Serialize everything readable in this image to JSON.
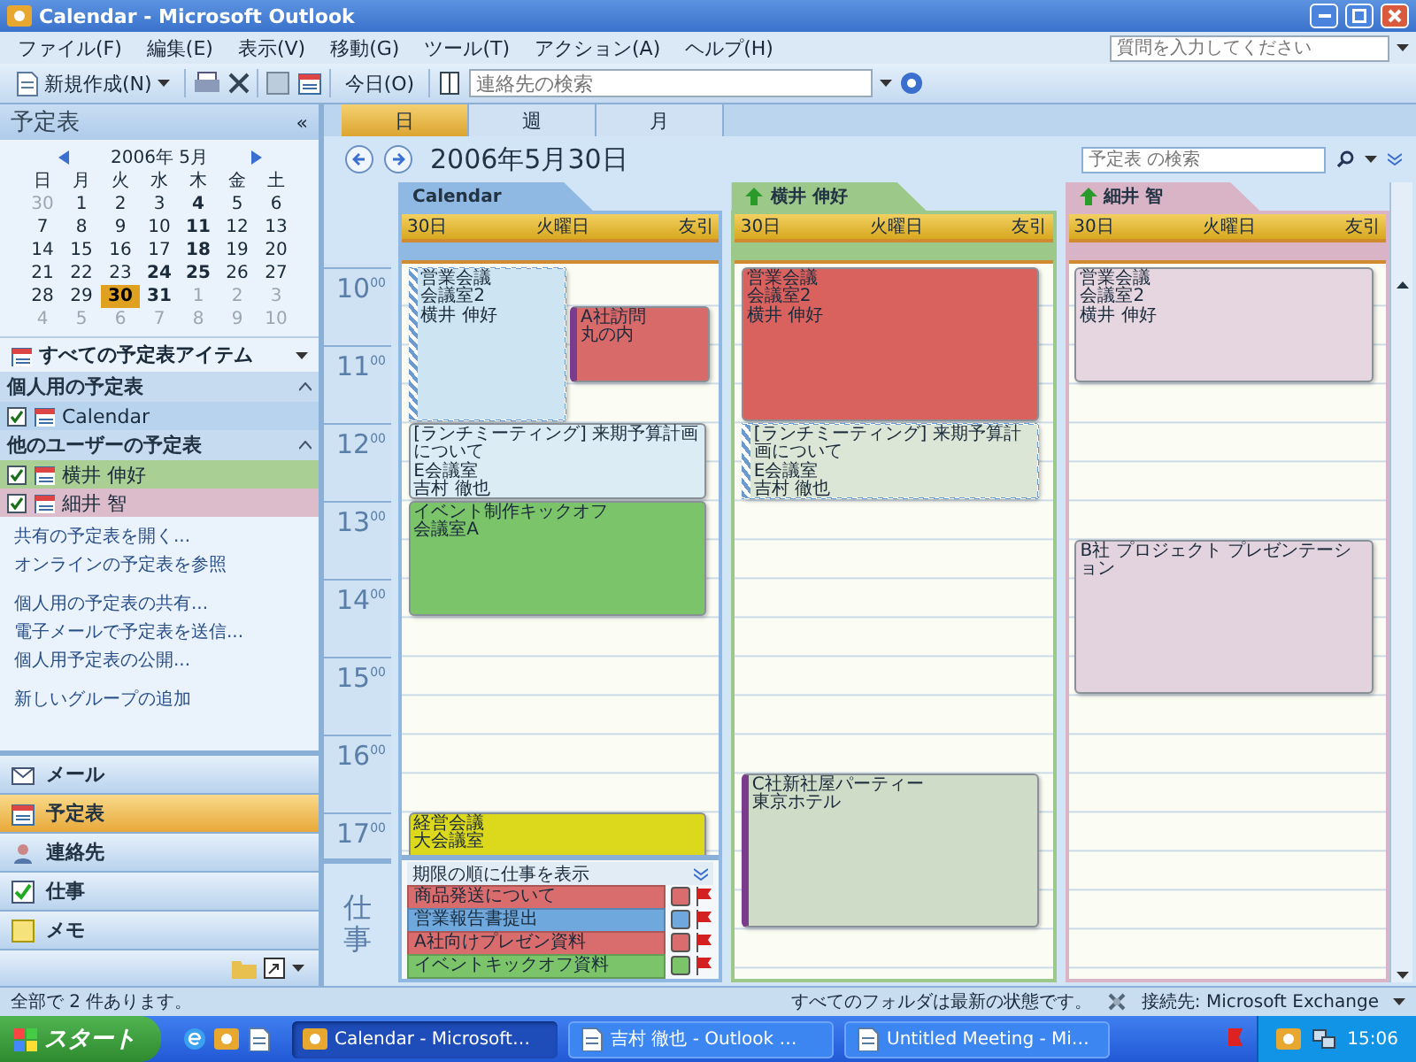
{
  "window": {
    "title": "Calendar - Microsoft Outlook"
  },
  "menu": [
    "ファイル(F)",
    "編集(E)",
    "表示(V)",
    "移動(G)",
    "ツール(T)",
    "アクション(A)",
    "ヘルプ(H)"
  ],
  "help_search": {
    "placeholder": "質問を入力してください"
  },
  "toolbar": {
    "new_button": "新規作成(N)",
    "today_button": "今日(O)",
    "contact_search": {
      "placeholder": "連絡先の検索"
    }
  },
  "navigation_pane": {
    "title": "予定表",
    "collapse": "«",
    "mini_calendar": {
      "month": "2006年 5月",
      "weekdays": [
        "日",
        "月",
        "火",
        "水",
        "木",
        "金",
        "土"
      ],
      "weeks": [
        [
          {
            "day": "30",
            "muted": true,
            "bold": false,
            "selected": false
          },
          {
            "day": "1",
            "muted": false,
            "bold": false,
            "selected": false
          },
          {
            "day": "2",
            "muted": false,
            "bold": false,
            "selected": false
          },
          {
            "day": "3",
            "muted": false,
            "bold": false,
            "selected": false
          },
          {
            "day": "4",
            "muted": false,
            "bold": true,
            "selected": false
          },
          {
            "day": "5",
            "muted": false,
            "bold": false,
            "selected": false
          },
          {
            "day": "6",
            "muted": false,
            "bold": false,
            "selected": false
          }
        ],
        [
          {
            "day": "7",
            "muted": false,
            "bold": false,
            "selected": false
          },
          {
            "day": "8",
            "muted": false,
            "bold": false,
            "selected": false
          },
          {
            "day": "9",
            "muted": false,
            "bold": false,
            "selected": false
          },
          {
            "day": "10",
            "muted": false,
            "bold": false,
            "selected": false
          },
          {
            "day": "11",
            "muted": false,
            "bold": true,
            "selected": false
          },
          {
            "day": "12",
            "muted": false,
            "bold": false,
            "selected": false
          },
          {
            "day": "13",
            "muted": false,
            "bold": false,
            "selected": false
          }
        ],
        [
          {
            "day": "14",
            "muted": false,
            "bold": false,
            "selected": false
          },
          {
            "day": "15",
            "muted": false,
            "bold": false,
            "selected": false
          },
          {
            "day": "16",
            "muted": false,
            "bold": false,
            "selected": false
          },
          {
            "day": "17",
            "muted": false,
            "bold": false,
            "selected": false
          },
          {
            "day": "18",
            "muted": false,
            "bold": true,
            "selected": false
          },
          {
            "day": "19",
            "muted": false,
            "bold": false,
            "selected": false
          },
          {
            "day": "20",
            "muted": false,
            "bold": false,
            "selected": false
          }
        ],
        [
          {
            "day": "21",
            "muted": false,
            "bold": false,
            "selected": false
          },
          {
            "day": "22",
            "muted": false,
            "bold": false,
            "selected": false
          },
          {
            "day": "23",
            "muted": false,
            "bold": false,
            "selected": false
          },
          {
            "day": "24",
            "muted": false,
            "bold": true,
            "selected": false
          },
          {
            "day": "25",
            "muted": false,
            "bold": true,
            "selected": false
          },
          {
            "day": "26",
            "muted": false,
            "bold": false,
            "selected": false
          },
          {
            "day": "27",
            "muted": false,
            "bold": false,
            "selected": false
          }
        ],
        [
          {
            "day": "28",
            "muted": false,
            "bold": false,
            "selected": false
          },
          {
            "day": "29",
            "muted": false,
            "bold": false,
            "selected": false
          },
          {
            "day": "30",
            "muted": false,
            "bold": true,
            "selected": true
          },
          {
            "day": "31",
            "muted": false,
            "bold": true,
            "selected": false
          },
          {
            "day": "1",
            "muted": true,
            "bold": false,
            "selected": false
          },
          {
            "day": "2",
            "muted": true,
            "bold": false,
            "selected": false
          },
          {
            "day": "3",
            "muted": true,
            "bold": false,
            "selected": false
          }
        ],
        [
          {
            "day": "4",
            "muted": true,
            "bold": false,
            "selected": false
          },
          {
            "day": "5",
            "muted": true,
            "bold": false,
            "selected": false
          },
          {
            "day": "6",
            "muted": true,
            "bold": false,
            "selected": false
          },
          {
            "day": "7",
            "muted": true,
            "bold": false,
            "selected": false
          },
          {
            "day": "8",
            "muted": true,
            "bold": false,
            "selected": false
          },
          {
            "day": "9",
            "muted": true,
            "bold": false,
            "selected": false
          },
          {
            "day": "10",
            "muted": true,
            "bold": false,
            "selected": false
          }
        ]
      ]
    },
    "all_items": "すべての予定表アイテム",
    "groups": [
      {
        "title": "個人用の予定表",
        "items": [
          {
            "label": "Calendar",
            "checked": true,
            "color": "#b7d3ee"
          }
        ]
      },
      {
        "title": "他のユーザーの予定表",
        "items": [
          {
            "label": "横井 伸好",
            "checked": true,
            "color": "#a9cf95"
          },
          {
            "label": "細井 智",
            "checked": true,
            "color": "#dcbccb"
          }
        ]
      }
    ],
    "link_groups": [
      [
        "共有の予定表を開く...",
        "オンラインの予定表を参照"
      ],
      [
        "個人用の予定表の共有...",
        "電子メールで予定表を送信...",
        "個人用予定表の公開..."
      ],
      [
        "新しいグループの追加"
      ]
    ],
    "modules": [
      {
        "label": "メール",
        "kind": "mail",
        "selected": false
      },
      {
        "label": "予定表",
        "kind": "calendar",
        "selected": true
      },
      {
        "label": "連絡先",
        "kind": "contacts",
        "selected": false
      },
      {
        "label": "仕事",
        "kind": "tasks",
        "selected": false
      },
      {
        "label": "メモ",
        "kind": "notes",
        "selected": false
      }
    ]
  },
  "view_tabs": [
    {
      "label": "日",
      "selected": true
    },
    {
      "label": "週",
      "selected": false
    },
    {
      "label": "月",
      "selected": false
    }
  ],
  "date_title": "2006年5月30日",
  "calendar_search": {
    "placeholder": "予定表 の検索"
  },
  "time_labels": [
    "10$^{00}$",
    "11$^{00}$",
    "12$^{00}$",
    "13$^{00}$",
    "14$^{00}$",
    "15$^{00}$",
    "16$^{00}$",
    "17$^{00}$"
  ],
  "tasks_label": "仕事",
  "calendars": [
    {
      "name": "Calendar",
      "shared": false,
      "color": "#8fb9e3",
      "header": {
        "date": "30日",
        "weekday": "火曜日",
        "rokuyo": "友引"
      },
      "events": [
        {
          "subject": "営業会議",
          "location": "会議室2",
          "organizer": "横井 伸好",
          "kind": "tentative",
          "color": "#cde4f2"
        },
        {
          "subject": "A社訪問",
          "location": "丸の内",
          "kind": "out_of_office",
          "color": "#d86a6a"
        },
        {
          "subject": "[ランチミーティング] 来期予算計画について",
          "location": "E会議室",
          "organizer": "吉村 徹也",
          "kind": "busy",
          "color": "#dcecf4"
        },
        {
          "subject": "イベント制作キックオフ",
          "location": "会議室A",
          "kind": "busy",
          "color": "#7cc46a"
        },
        {
          "subject": "経営会議",
          "location": "大会議室",
          "kind": "busy",
          "color": "#dcd81c"
        }
      ]
    },
    {
      "name": "横井 伸好",
      "shared": true,
      "color": "#9cc98a",
      "header": {
        "date": "30日",
        "weekday": "火曜日",
        "rokuyo": "友引"
      },
      "events": [
        {
          "subject": "営業会議",
          "location": "会議室2",
          "organizer": "横井 伸好",
          "kind": "busy",
          "color": "#d9625f"
        },
        {
          "subject": "[ランチミーティング] 来期予算計画について",
          "location": "E会議室",
          "organizer": "吉村 徹也",
          "kind": "tentative",
          "color": "#dbe6d6"
        },
        {
          "subject": "C社新社屋パーティー",
          "location": "東京ホテル",
          "kind": "out_of_office",
          "color": "#cfdcc8"
        }
      ]
    },
    {
      "name": "細井 智",
      "shared": true,
      "color": "#d9b3c6",
      "header": {
        "date": "30日",
        "weekday": "火曜日",
        "rokuyo": "友引"
      },
      "events": [
        {
          "subject": "営業会議",
          "location": "会議室2",
          "organizer": "横井 伸好",
          "kind": "busy",
          "color": "#e6d6e0"
        },
        {
          "subject": "B社 プロジェクト プレゼンテーション",
          "kind": "busy",
          "color": "#e3d3de"
        }
      ]
    }
  ],
  "task_pane": {
    "title": "期限の順に仕事を表示",
    "tasks": [
      {
        "subject": "商品発送について",
        "color": "#d96c6c",
        "flagged": true
      },
      {
        "subject": "営業報告書提出",
        "color": "#6fa8dc",
        "flagged": true
      },
      {
        "subject": "A社向けプレゼン資料",
        "color": "#d96c6c",
        "flagged": true
      },
      {
        "subject": "イベントキックオフ資料",
        "color": "#7cc46a",
        "flagged": true
      }
    ]
  },
  "status_bar": {
    "count": "全部で 2 件あります。",
    "sync": "すべてのフォルダは最新の状態です。",
    "connection": "接続先: Microsoft Exchange"
  },
  "taskbar": {
    "start": "スタート",
    "tasks": [
      {
        "label": "Calendar - Microsoft…",
        "selected": true
      },
      {
        "label": "吉村 徹也 - Outlook …",
        "selected": false
      },
      {
        "label": "Untitled Meeting - Mi…",
        "selected": false
      }
    ],
    "clock": "15:06"
  }
}
